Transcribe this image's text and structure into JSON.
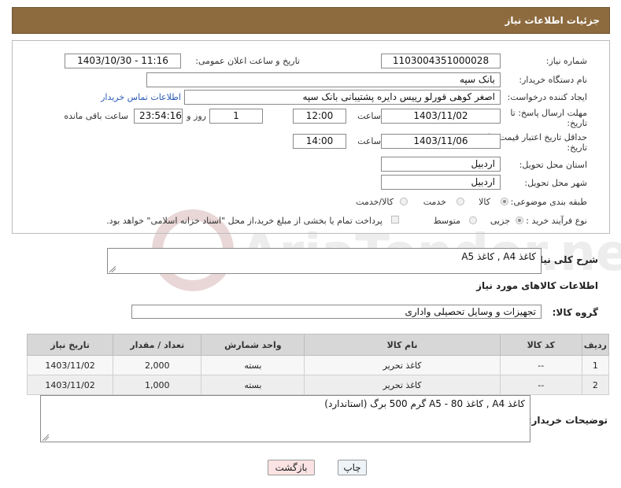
{
  "header": {
    "title": "جزئیات اطلاعات نیاز"
  },
  "labels": {
    "need_number": "شماره نیاز:",
    "announce_datetime": "تاریخ و ساعت اعلان عمومی:",
    "buyer_org": "نام دستگاه خریدار:",
    "requester": "ایجاد کننده درخواست:",
    "contact_link": "اطلاعات تماس خریدار",
    "reply_deadline": "مهلت ارسال پاسخ: تا تاریخ:",
    "time": "ساعت",
    "day_and": "روز و",
    "remaining": "ساعت باقی مانده",
    "price_validity": "حداقل تاریخ اعتبار قیمت: تا تاریخ:",
    "province": "استان محل تحویل:",
    "city": "شهر محل تحویل:",
    "category": "طبقه بندی موضوعی:",
    "process_type": "نوع فرآیند خرید :",
    "description_title": "شرح کلی نیاز:",
    "goods_info": "اطلاعات کالاهای مورد نیاز",
    "goods_group": "گروه کالا:",
    "buyer_notes": "توضیحات خریدار:"
  },
  "fields": {
    "need_number": "1103004351000028",
    "announce_datetime": "1403/10/30 - 11:16",
    "buyer_org": "بانک سپه",
    "requester": "اصغر کوهی قورلو رییس دایره پشتیبانی بانک سپه",
    "reply_date": "1403/11/02",
    "reply_time": "12:00",
    "days": "1",
    "remaining_time": "23:54:16",
    "validity_date": "1403/11/06",
    "validity_time": "14:00",
    "province": "اردبیل",
    "city": "اردبیل",
    "description": "کاغذ A4 , کاغذ A5",
    "goods_group": "تجهیزات و وسایل تحصیلی واداری",
    "buyer_notes": "کاغذ A4 , کاغذ 80 -  A5 گرم 500 برگ (استاندارد)"
  },
  "category_options": {
    "goods": "کالا",
    "service": "خدمت",
    "goods_service": "کالا/خدمت",
    "selected": "goods"
  },
  "process_options": {
    "partial": "جزیی",
    "medium": "متوسط",
    "selected": "partial",
    "payment_note": "پرداخت تمام یا بخشی از مبلغ خرید،از محل \"اسناد خزانه اسلامی\" خواهد بود."
  },
  "table": {
    "headers": [
      "ردیف",
      "کد کالا",
      "نام کالا",
      "واحد شمارش",
      "تعداد / مقدار",
      "تاریخ نیاز"
    ],
    "rows": [
      [
        "1",
        "--",
        "کاغذ تحریر",
        "بسته",
        "2,000",
        "1403/11/02"
      ],
      [
        "2",
        "--",
        "کاغذ تحریر",
        "بسته",
        "1,000",
        "1403/11/02"
      ]
    ]
  },
  "buttons": {
    "print": "چاپ",
    "back": "بازگشت"
  },
  "watermark": {
    "text": "AriaTender.neT"
  },
  "colors": {
    "header_bg": "#8d6b3f",
    "link": "#2a5bb4",
    "back_button_bg": "#fbe3e3",
    "print_button_bg": "#eef3f7"
  }
}
